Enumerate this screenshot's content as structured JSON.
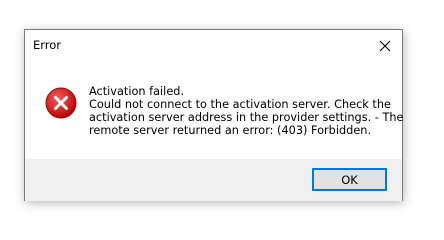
{
  "window": {
    "title": "Error",
    "close_icon": "close-icon"
  },
  "message": {
    "icon": "error-icon",
    "lines": [
      "Activation failed.",
      "Could not connect to the activation server. Check the",
      "activation server address in the provider settings. - The",
      "remote server returned an error: (403) Forbidden."
    ]
  },
  "buttons": {
    "ok_label": "OK"
  },
  "colors": {
    "error_red": "#e81123",
    "focus_blue": "#0078d7"
  }
}
